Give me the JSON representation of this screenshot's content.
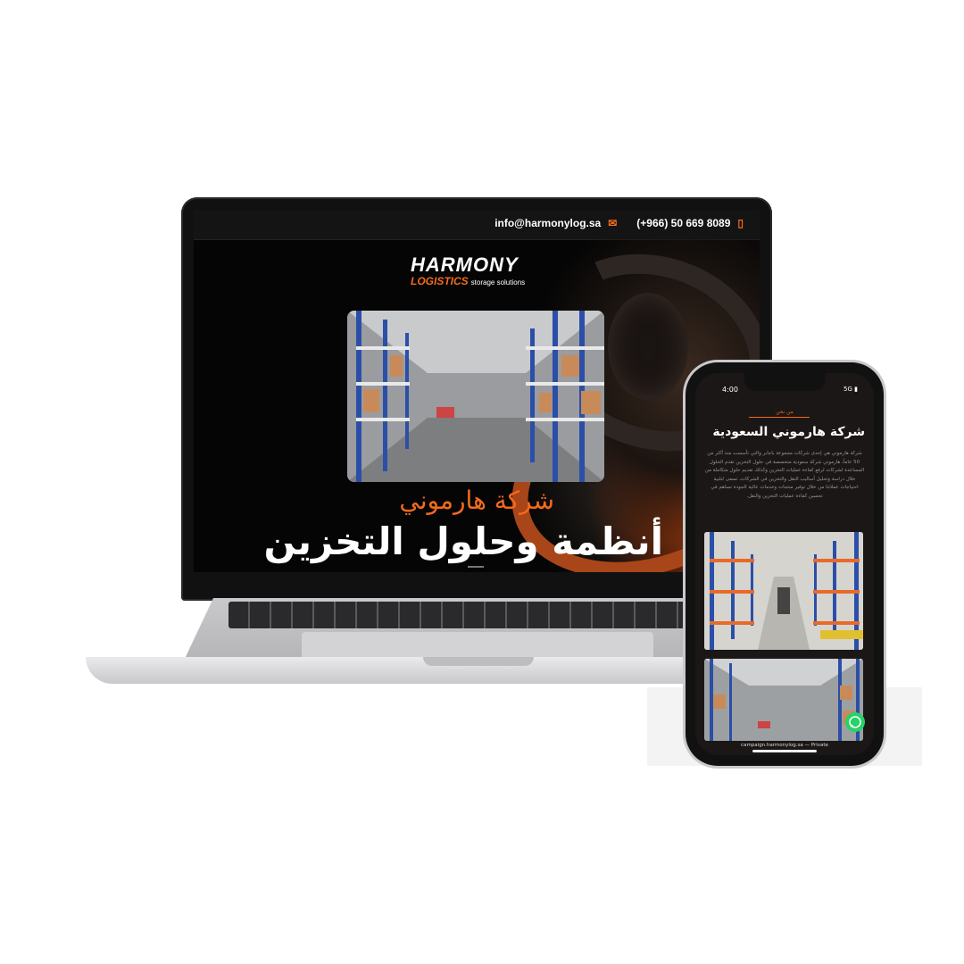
{
  "laptop": {
    "topbar": {
      "email": "info@harmonylog.sa",
      "phone": "(+966) 50 669 8089"
    },
    "logo": {
      "primary": "HARMONY",
      "secondary": "LOGISTICS",
      "tagline": "storage solutions"
    },
    "hero": {
      "subtitle": "شركة هارموني",
      "title": "أنظمة وحلول التخزين"
    }
  },
  "phone": {
    "status": {
      "time": "4:00",
      "network": "5G"
    },
    "tab_label": "من نحن",
    "heading": "شركة هارموني السعودية",
    "paragraph": "شركة هارموني هي إحدى شركات مجموعة باجابر والتي تأسست منذ أكثر من 50 عاماً، هارموني شركة سعودية متخصصة في حلول التخزين تقدم الحلول المساعدة لشركات لرفع كفاءة عمليات التخزين وكذلك تقديم حلول متكاملة من خلال دراسة وتحليل أساليب النقل والتخزين في الشركات، تسعى لتلبية احتياجات عملائنا من خلال توفير منتجات وخدمات عالية الجودة تساهم في تحسين كفاءة عمليات التخزين والنقل.",
    "url_bar": "campaign.harmonylog.sa — Private"
  },
  "colors": {
    "accent": "#f36a1d",
    "background": "#050505",
    "whatsapp": "#25d366"
  },
  "icons": [
    "mail-icon",
    "phone-icon",
    "whatsapp-icon"
  ]
}
